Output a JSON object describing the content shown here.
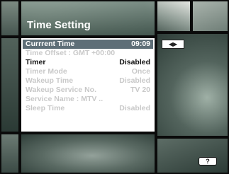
{
  "screen": {
    "title": "Time Setting"
  },
  "menu": {
    "rows": [
      {
        "label": "Currrent Time",
        "value": "09:09",
        "state": "selected"
      },
      {
        "label": "Time Offset : GMT +00:00",
        "value": "",
        "state": "dim"
      },
      {
        "label": "Timer",
        "value": "Disabled",
        "state": "active"
      },
      {
        "label": "Timer Mode",
        "value": "Once",
        "state": "dim"
      },
      {
        "label": "Wakeup Time",
        "value": "Disabled",
        "state": "dim"
      },
      {
        "label": "Wakeup Service No.",
        "value": "TV 20",
        "state": "dim"
      },
      {
        "label": "Service Name : MTV ..",
        "value": "",
        "state": "dim"
      },
      {
        "label": "Sleep Time",
        "value": "Disabled",
        "state": "dim"
      }
    ]
  },
  "controls": {
    "nav_hint": "◀▶",
    "help_label": "?"
  },
  "colors": {
    "selected_row_bg": "#5e6e77",
    "panel_bg": "#ffffff",
    "dim_text": "#c9c9c9"
  }
}
